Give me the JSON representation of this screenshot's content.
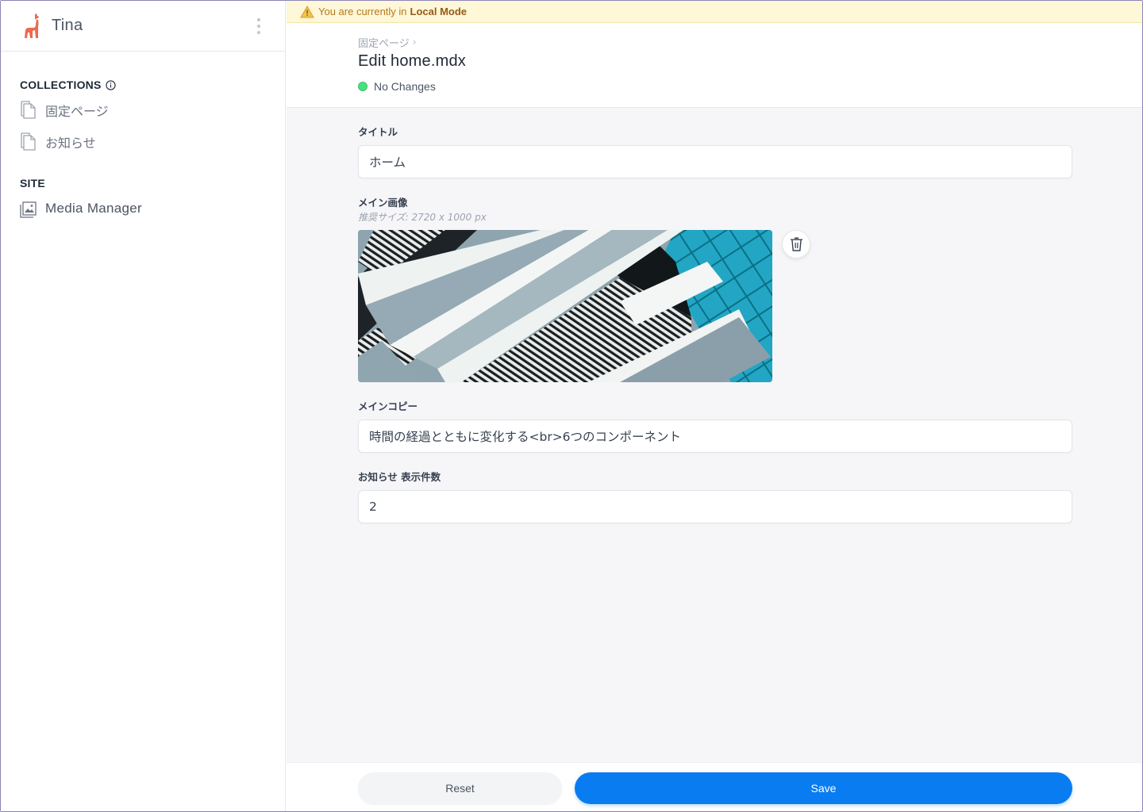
{
  "app": {
    "title": "Tina",
    "logo_icon": "llama-icon"
  },
  "sidebar": {
    "collections_heading": "COLLECTIONS",
    "collections": [
      {
        "label": "固定ページ",
        "icon": "document-icon"
      },
      {
        "label": "お知らせ",
        "icon": "document-icon"
      }
    ],
    "site_heading": "SITE",
    "site_items": [
      {
        "label": "Media Manager",
        "icon": "image-icon"
      }
    ]
  },
  "banner": {
    "prefix": "You are currently in",
    "mode": "Local Mode",
    "icon": "warning-icon"
  },
  "header": {
    "breadcrumb": "固定ページ",
    "title": "Edit home.mdx",
    "status": "No Changes",
    "status_color": "#4ade80"
  },
  "form": {
    "title_field": {
      "label": "タイトル",
      "value": "ホーム"
    },
    "image_field": {
      "label": "メイン画像",
      "hint": "推奨サイズ: 2720 x 1000 px"
    },
    "copy_field": {
      "label": "メインコピー",
      "value": "時間の経過とともに変化する<br>6つのコンポーネント"
    },
    "count_field": {
      "label": "お知らせ 表示件数",
      "value": "2"
    }
  },
  "footer": {
    "reset_label": "Reset",
    "save_label": "Save",
    "save_color": "#0a7cf2"
  }
}
